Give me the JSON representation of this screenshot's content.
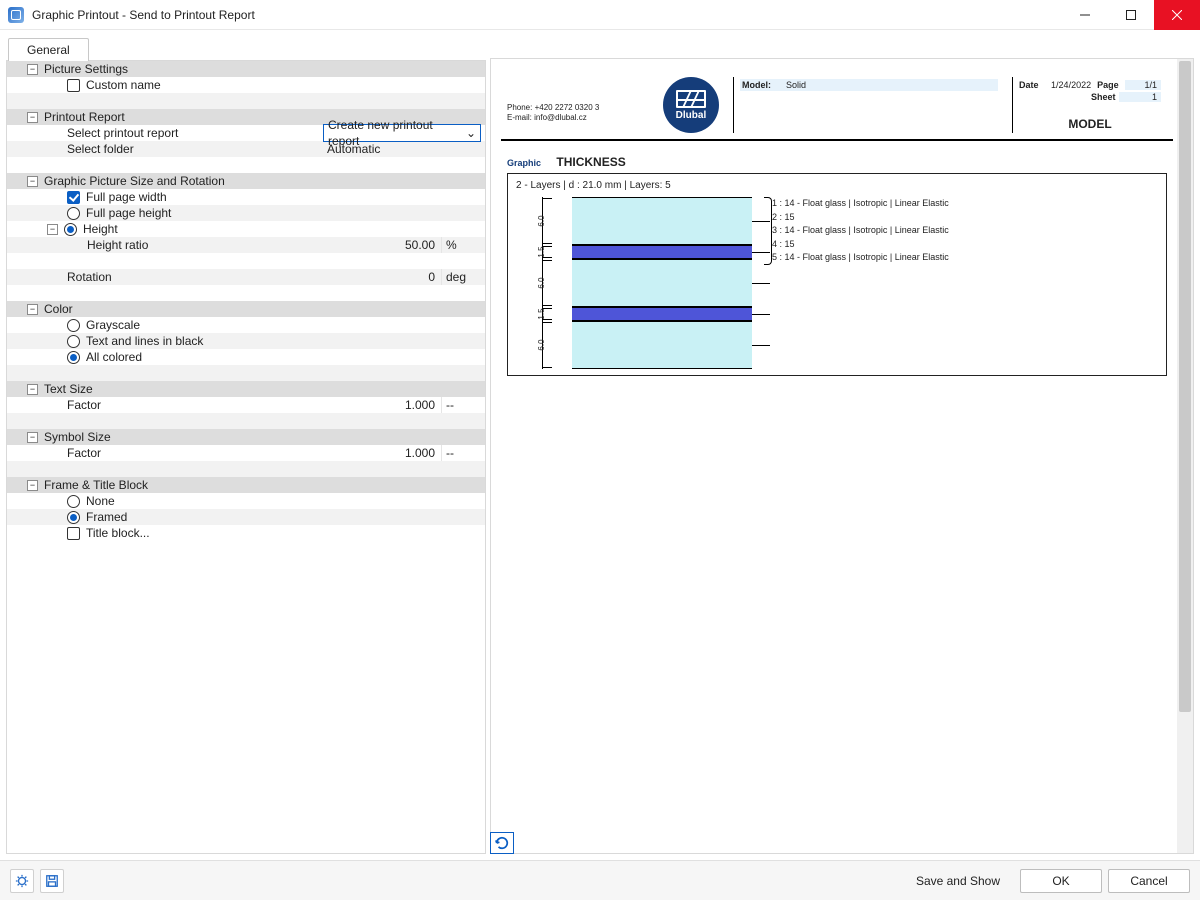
{
  "window": {
    "title": "Graphic Printout - Send to Printout Report"
  },
  "tabs": {
    "general": "General"
  },
  "groups": {
    "picture_settings": {
      "label": "Picture Settings",
      "custom_name": "Custom name"
    },
    "printout_report": {
      "label": "Printout Report",
      "select_report_label": "Select printout report",
      "select_report_value": "Create new printout report",
      "select_folder_label": "Select folder",
      "select_folder_value": "Automatic"
    },
    "size_rotation": {
      "label": "Graphic Picture Size and Rotation",
      "full_width": "Full page width",
      "full_height": "Full page height",
      "height": "Height",
      "height_ratio_label": "Height ratio",
      "height_ratio_value": "50.00",
      "height_ratio_unit": "%",
      "rotation_label": "Rotation",
      "rotation_value": "0",
      "rotation_unit": "deg"
    },
    "color": {
      "label": "Color",
      "grayscale": "Grayscale",
      "text_lines_black": "Text and lines in black",
      "all_colored": "All colored"
    },
    "text_size": {
      "label": "Text Size",
      "factor_label": "Factor",
      "factor_value": "1.000",
      "factor_unit": "--"
    },
    "symbol_size": {
      "label": "Symbol Size",
      "factor_label": "Factor",
      "factor_value": "1.000",
      "factor_unit": "--"
    },
    "frame": {
      "label": "Frame & Title Block",
      "none": "None",
      "framed": "Framed",
      "title_block": "Title block..."
    }
  },
  "report": {
    "company_phone": "Phone: +420 2272 0320 3",
    "company_email": "E-mail: info@dlubal.cz",
    "logo_text": "Dlubal",
    "model_label": "Model:",
    "model_value": "Solid",
    "date_label": "Date",
    "date_value": "1/24/2022",
    "page_label": "Page",
    "page_value": "1/1",
    "sheet_label": "Sheet",
    "sheet_value": "1",
    "model_word": "MODEL",
    "graphic_label": "Graphic",
    "title": "THICKNESS",
    "caption": "2 - Layers | d : 21.0 mm | Layers: 5",
    "layers": [
      {
        "dim": "6.0",
        "legend": "1 : 14 - Float glass | Isotropic | Linear Elastic"
      },
      {
        "dim": "1.5",
        "legend": "2 : 15"
      },
      {
        "dim": "6.0",
        "legend": "3 : 14 - Float glass | Isotropic | Linear Elastic"
      },
      {
        "dim": "1.5",
        "legend": "4 : 15"
      },
      {
        "dim": "6.0",
        "legend": "5 : 14 - Float glass | Isotropic | Linear Elastic"
      }
    ]
  },
  "footer": {
    "save_and_show": "Save and Show",
    "ok": "OK",
    "cancel": "Cancel"
  }
}
